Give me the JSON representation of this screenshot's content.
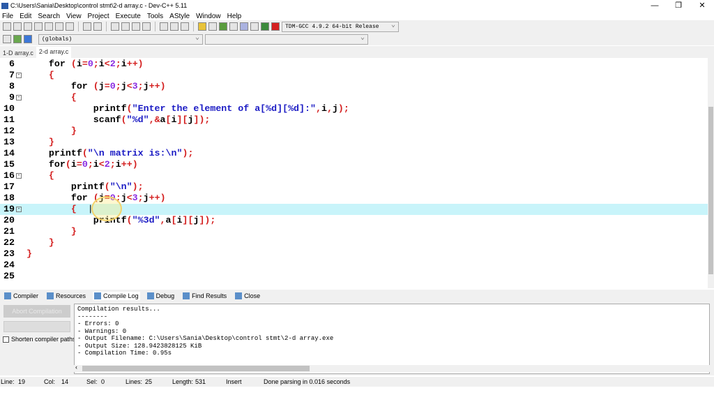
{
  "window": {
    "title": "C:\\Users\\Sania\\Desktop\\control stmt\\2-d array.c - Dev-C++ 5.11",
    "minimize": "—",
    "maximize": "❐",
    "close": "✕"
  },
  "menu": [
    "File",
    "Edit",
    "Search",
    "View",
    "Project",
    "Execute",
    "Tools",
    "AStyle",
    "Window",
    "Help"
  ],
  "toolbar": {
    "compiler_select": "TDM-GCC 4.9.2 64-bit Release",
    "scope_select": "(globals)",
    "function_select": ""
  },
  "file_tabs": [
    {
      "label": "1-D array.c",
      "active": false
    },
    {
      "label": "2-d array.c",
      "active": true
    }
  ],
  "editor": {
    "current_line": 19,
    "lines": [
      {
        "n": "6",
        "text": "    for (i=0;i<2;i++)",
        "fold": false
      },
      {
        "n": "7",
        "text": "    {",
        "fold": true
      },
      {
        "n": "8",
        "text": "        for (j=0;j<3;j++)",
        "fold": false
      },
      {
        "n": "9",
        "text": "        {",
        "fold": true
      },
      {
        "n": "10",
        "text": "            printf(\"Enter the element of a[%d][%d]:\",i,j);",
        "fold": false
      },
      {
        "n": "11",
        "text": "            scanf(\"%d\",&a[i][j]);",
        "fold": false
      },
      {
        "n": "12",
        "text": "        }",
        "fold": false
      },
      {
        "n": "13",
        "text": "    }",
        "fold": false
      },
      {
        "n": "14",
        "text": "    printf(\"\\n matrix is:\\n\");",
        "fold": false
      },
      {
        "n": "15",
        "text": "    for(i=0;i<2;i++)",
        "fold": false
      },
      {
        "n": "16",
        "text": "    {",
        "fold": true
      },
      {
        "n": "17",
        "text": "        printf(\"\\n\");",
        "fold": false
      },
      {
        "n": "18",
        "text": "        for (j=0;j<3;j++)",
        "fold": false
      },
      {
        "n": "19",
        "text": "        {  |",
        "fold": true
      },
      {
        "n": "20",
        "text": "            printf(\"%3d\",a[i][j]);",
        "fold": false
      },
      {
        "n": "21",
        "text": "        }",
        "fold": false
      },
      {
        "n": "22",
        "text": "    }",
        "fold": false
      },
      {
        "n": "23",
        "text": "}",
        "fold": false
      },
      {
        "n": "24",
        "text": "",
        "fold": false
      },
      {
        "n": "25",
        "text": "",
        "fold": false
      }
    ]
  },
  "bottom_tabs": [
    {
      "label": "Compiler",
      "active": false
    },
    {
      "label": "Resources",
      "active": false
    },
    {
      "label": "Compile Log",
      "active": true
    },
    {
      "label": "Debug",
      "active": false
    },
    {
      "label": "Find Results",
      "active": false
    },
    {
      "label": "Close",
      "active": false
    }
  ],
  "compile_panel": {
    "abort_label": "Abort Compilation",
    "shorten_paths_label": "Shorten compiler paths",
    "shorten_paths_checked": false,
    "log": [
      "Compilation results...",
      "--------",
      "- Errors: 0",
      "- Warnings: 0",
      "- Output Filename: C:\\Users\\Sania\\Desktop\\control stmt\\2-d array.exe",
      "- Output Size: 128.9423828125 KiB",
      "- Compilation Time: 0.95s"
    ]
  },
  "status": {
    "line_label": "Line:",
    "line": "19",
    "col_label": "Col:",
    "col": "14",
    "sel_label": "Sel:",
    "sel": "0",
    "lines_label": "Lines:",
    "lines": "25",
    "length_label": "Length:",
    "length": "531",
    "mode": "Insert",
    "message": "Done parsing in 0.016 seconds"
  },
  "colors": {
    "keyword": "#000000",
    "string": "#1b1bc4",
    "number": "#8a2be2",
    "symbol": "#d41f1f",
    "current_line": "#c8f4fa"
  }
}
